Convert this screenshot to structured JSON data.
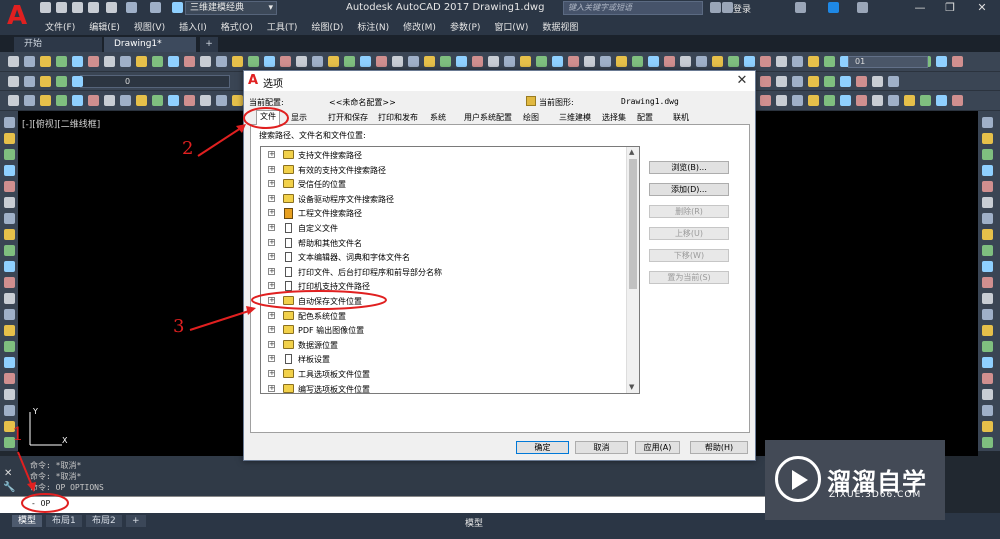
{
  "titlebar": {
    "workspace": "三维建模经典",
    "app_title": "Autodesk AutoCAD 2017    Drawing1.dwg",
    "search_placeholder": "键入关键字或短语",
    "login": "登录",
    "minimize": "—",
    "restore": "❐",
    "close": "✕"
  },
  "menu": [
    "文件(F)",
    "编辑(E)",
    "视图(V)",
    "插入(I)",
    "格式(O)",
    "工具(T)",
    "绘图(D)",
    "标注(N)",
    "修改(M)",
    "参数(P)",
    "窗口(W)",
    "数据视图"
  ],
  "doc_tabs": {
    "start": "开始",
    "drawing": "Drawing1*",
    "plus": "+"
  },
  "toolbar": {
    "layer": "0",
    "layer_combo": "01"
  },
  "view_label": "[-][俯视][二维线框]",
  "command": {
    "history": [
      "命令: *取消*",
      "命令: *取消*",
      "命令: OP OPTIONS"
    ],
    "input": "- OP"
  },
  "status": {
    "model_tab": "模型",
    "layout1": "布局1",
    "layout2": "布局2",
    "plus": "+",
    "model_label": "模型"
  },
  "dialog": {
    "title": "选项",
    "profile_label": "当前配置:",
    "profile_value": "<<未命名配置>>",
    "drawing_label": "当前图形:",
    "drawing_value": "Drawing1.dwg",
    "tabs": [
      "文件",
      "显示",
      "打开和保存",
      "打印和发布",
      "系统",
      "用户系统配置",
      "绘图",
      "三维建模",
      "选择集",
      "配置",
      "联机"
    ],
    "panel_label": "搜索路径、文件名和文件位置:",
    "tree": [
      {
        "label": "支持文件搜索路径",
        "icon": "folder"
      },
      {
        "label": "有效的支持文件搜索路径",
        "icon": "folder"
      },
      {
        "label": "受信任的位置",
        "icon": "folder"
      },
      {
        "label": "设备驱动程序文件搜索路径",
        "icon": "folder"
      },
      {
        "label": "工程文件搜索路径",
        "icon": "book"
      },
      {
        "label": "自定义文件",
        "icon": "doc"
      },
      {
        "label": "帮助和其他文件名",
        "icon": "doc"
      },
      {
        "label": "文本编辑器、词典和字体文件名",
        "icon": "doc"
      },
      {
        "label": "打印文件、后台打印程序和前导部分名称",
        "icon": "doc"
      },
      {
        "label": "打印机支持文件路径",
        "icon": "doc"
      },
      {
        "label": "自动保存文件位置",
        "icon": "folder"
      },
      {
        "label": "配色系统位置",
        "icon": "folder"
      },
      {
        "label": "PDF 输出图像位置",
        "icon": "folder"
      },
      {
        "label": "数据源位置",
        "icon": "folder"
      },
      {
        "label": "样板设置",
        "icon": "doc"
      },
      {
        "label": "工具选项板文件位置",
        "icon": "folder"
      },
      {
        "label": "编写选项板文件位置",
        "icon": "folder"
      }
    ],
    "side_buttons": [
      {
        "label": "浏览(B)...",
        "enabled": true
      },
      {
        "label": "添加(D)...",
        "enabled": true
      },
      {
        "label": "删除(R)",
        "enabled": false
      },
      {
        "label": "上移(U)",
        "enabled": false
      },
      {
        "label": "下移(W)",
        "enabled": false
      },
      {
        "label": "置为当前(S)",
        "enabled": false
      }
    ],
    "ok": "确定",
    "cancel": "取消",
    "apply": "应用(A)",
    "help": "帮助(H)",
    "close": "✕"
  },
  "annotations": [
    "1",
    "2",
    "3"
  ],
  "watermark": {
    "title": "溜溜自学",
    "url": "ZIXUE.3D66.COM"
  },
  "colors": {
    "annotation": "#e02020",
    "title_bg": "#2b3645",
    "canvas": "#000000"
  }
}
